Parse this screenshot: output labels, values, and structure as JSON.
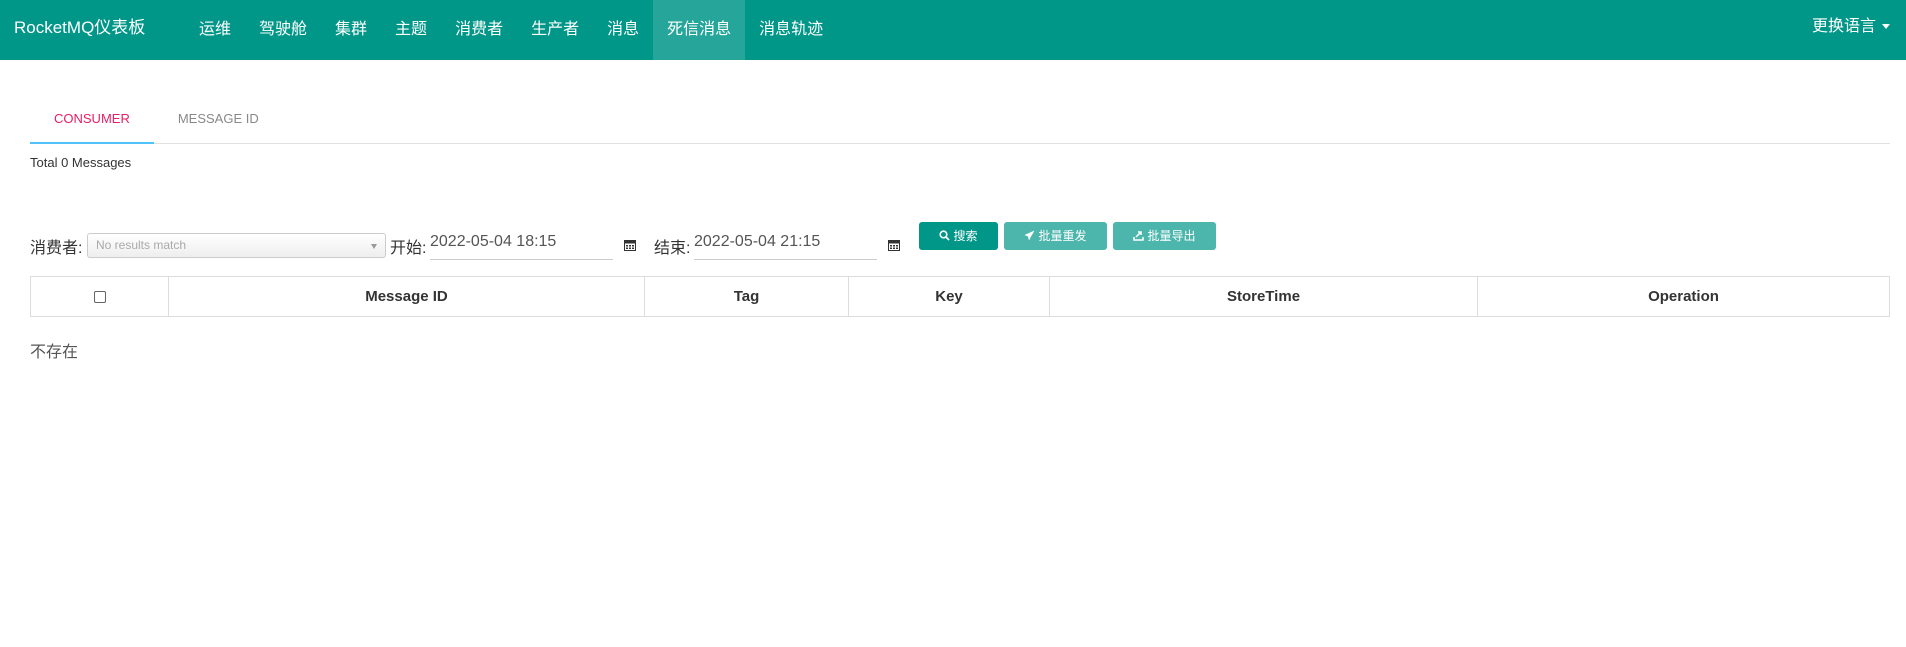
{
  "navbar": {
    "brand": "RocketMQ仪表板",
    "items": [
      {
        "label": "运维"
      },
      {
        "label": "驾驶舱"
      },
      {
        "label": "集群"
      },
      {
        "label": "主题"
      },
      {
        "label": "消费者"
      },
      {
        "label": "生产者"
      },
      {
        "label": "消息"
      },
      {
        "label": "死信消息",
        "active": true
      },
      {
        "label": "消息轨迹"
      }
    ],
    "language": "更换语言"
  },
  "tabs": [
    {
      "label": "CONSUMER",
      "active": true
    },
    {
      "label": "MESSAGE ID"
    }
  ],
  "total_text": "Total 0 Messages",
  "filter": {
    "consumer_label": "消费者:",
    "consumer_placeholder": "No results match",
    "start_label": "开始:",
    "start_value": "2022-05-04 18:15",
    "end_label": "结束:",
    "end_value": "2022-05-04 21:15",
    "search_button": "搜索",
    "batch_resend_button": "批量重发",
    "batch_export_button": "批量导出"
  },
  "table": {
    "columns": [
      "Message ID",
      "Tag",
      "Key",
      "StoreTime",
      "Operation"
    ]
  },
  "empty_text": "不存在",
  "colors": {
    "primary": "#009688",
    "primary_light": "#4db6ac",
    "nav_active": "#26a69a",
    "tab_active_text": "#e91e63",
    "tab_active_underline": "#4fc3f7"
  },
  "icons": {
    "search": "search-icon",
    "resend": "paper-plane-icon",
    "export": "export-icon",
    "calendar": "calendar-icon",
    "dropdown": "caret-down-icon"
  }
}
